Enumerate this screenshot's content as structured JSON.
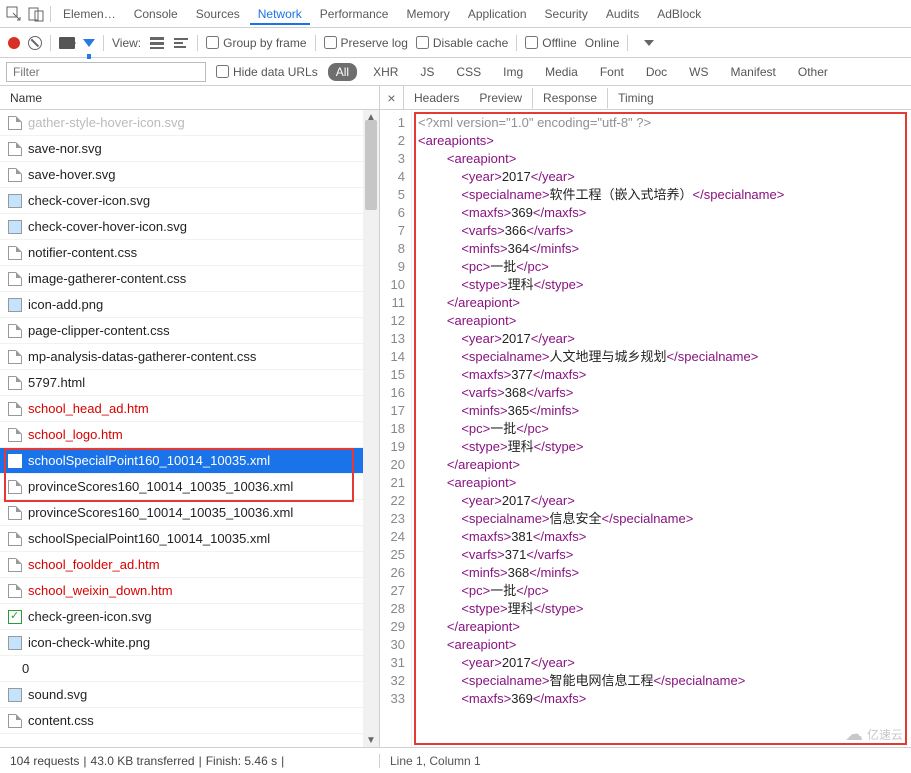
{
  "top_tabs": {
    "t0": "Elemen…",
    "t1": "Console",
    "t2": "Sources",
    "t3": "Network",
    "t4": "Performance",
    "t5": "Memory",
    "t6": "Application",
    "t7": "Security",
    "t8": "Audits",
    "t9": "AdBlock"
  },
  "toolbar": {
    "view": "View:",
    "group": "Group by frame",
    "preserve": "Preserve log",
    "disable": "Disable cache",
    "offline": "Offline",
    "online": "Online"
  },
  "filter": {
    "placeholder": "Filter",
    "hide": "Hide data URLs",
    "types": {
      "all": "All",
      "xhr": "XHR",
      "js": "JS",
      "css": "CSS",
      "img": "Img",
      "media": "Media",
      "font": "Font",
      "doc": "Doc",
      "ws": "WS",
      "manifest": "Manifest",
      "other": "Other"
    }
  },
  "name_header": "Name",
  "files": [
    {
      "label": "gather-style-hover-icon.svg",
      "cls": "",
      "ico": "doc"
    },
    {
      "label": "save-nor.svg",
      "cls": "",
      "ico": "doc"
    },
    {
      "label": "save-hover.svg",
      "cls": "",
      "ico": "doc"
    },
    {
      "label": "check-cover-icon.svg",
      "cls": "",
      "ico": "img"
    },
    {
      "label": "check-cover-hover-icon.svg",
      "cls": "",
      "ico": "img"
    },
    {
      "label": "notifier-content.css",
      "cls": "",
      "ico": "doc"
    },
    {
      "label": "image-gatherer-content.css",
      "cls": "",
      "ico": "doc"
    },
    {
      "label": "icon-add.png",
      "cls": "",
      "ico": "img"
    },
    {
      "label": "page-clipper-content.css",
      "cls": "",
      "ico": "doc"
    },
    {
      "label": "mp-analysis-datas-gatherer-content.css",
      "cls": "",
      "ico": "doc"
    },
    {
      "label": "5797.html",
      "cls": "",
      "ico": "doc"
    },
    {
      "label": "school_head_ad.htm",
      "cls": "redlink",
      "ico": "doc"
    },
    {
      "label": "school_logo.htm",
      "cls": "redlink",
      "ico": "doc"
    },
    {
      "label": "schoolSpecialPoint160_10014_10035.xml",
      "cls": "sel",
      "ico": "doc"
    },
    {
      "label": "provinceScores160_10014_10035_10036.xml",
      "cls": "",
      "ico": "doc"
    },
    {
      "label": "provinceScores160_10014_10035_10036.xml",
      "cls": "",
      "ico": "doc"
    },
    {
      "label": "schoolSpecialPoint160_10014_10035.xml",
      "cls": "",
      "ico": "doc"
    },
    {
      "label": "school_foolder_ad.htm",
      "cls": "redlink",
      "ico": "doc"
    },
    {
      "label": "school_weixin_down.htm",
      "cls": "redlink",
      "ico": "doc"
    },
    {
      "label": "check-green-icon.svg",
      "cls": "",
      "ico": "chk"
    },
    {
      "label": "icon-check-white.png",
      "cls": "",
      "ico": "img"
    },
    {
      "label": "0",
      "cls": "",
      "ico": "zero"
    },
    {
      "label": "sound.svg",
      "cls": "",
      "ico": "img"
    },
    {
      "label": "content.css",
      "cls": "",
      "ico": "doc"
    }
  ],
  "resp_tabs": {
    "headers": "Headers",
    "preview": "Preview",
    "response": "Response",
    "timing": "Timing"
  },
  "status": {
    "requests": "104 requests",
    "sep1": "|",
    "transferred": "43.0 KB transferred",
    "sep2": "|",
    "finish": "Finish: 5.46 s",
    "sep3": "|",
    "cursor": "Line 1, Column 1"
  },
  "code_lines": [
    {
      "html": "<span class='cmt'>&lt;?xml version=\"1.0\" encoding=\"utf-8\" ?&gt;</span>"
    },
    {
      "html": "<span class='t'>&lt;areapionts&gt;</span>"
    },
    {
      "html": "        <span class='t'>&lt;areapiont&gt;</span>"
    },
    {
      "html": "            <span class='t'>&lt;year&gt;</span>2017<span class='t'>&lt;/year&gt;</span>"
    },
    {
      "html": "            <span class='t'>&lt;specialname&gt;</span>软件工程（嵌入式培养）<span class='t'>&lt;/specialname&gt;</span>"
    },
    {
      "html": "            <span class='t'>&lt;maxfs&gt;</span>369<span class='t'>&lt;/maxfs&gt;</span>"
    },
    {
      "html": "            <span class='t'>&lt;varfs&gt;</span>366<span class='t'>&lt;/varfs&gt;</span>"
    },
    {
      "html": "            <span class='t'>&lt;minfs&gt;</span>364<span class='t'>&lt;/minfs&gt;</span>"
    },
    {
      "html": "            <span class='t'>&lt;pc&gt;</span>一批<span class='t'>&lt;/pc&gt;</span>"
    },
    {
      "html": "            <span class='t'>&lt;stype&gt;</span>理科<span class='t'>&lt;/stype&gt;</span>"
    },
    {
      "html": "        <span class='t'>&lt;/areapiont&gt;</span>"
    },
    {
      "html": "        <span class='t'>&lt;areapiont&gt;</span>"
    },
    {
      "html": "            <span class='t'>&lt;year&gt;</span>2017<span class='t'>&lt;/year&gt;</span>"
    },
    {
      "html": "            <span class='t'>&lt;specialname&gt;</span>人文地理与城乡规划<span class='t'>&lt;/specialname&gt;</span>"
    },
    {
      "html": "            <span class='t'>&lt;maxfs&gt;</span>377<span class='t'>&lt;/maxfs&gt;</span>"
    },
    {
      "html": "            <span class='t'>&lt;varfs&gt;</span>368<span class='t'>&lt;/varfs&gt;</span>"
    },
    {
      "html": "            <span class='t'>&lt;minfs&gt;</span>365<span class='t'>&lt;/minfs&gt;</span>"
    },
    {
      "html": "            <span class='t'>&lt;pc&gt;</span>一批<span class='t'>&lt;/pc&gt;</span>"
    },
    {
      "html": "            <span class='t'>&lt;stype&gt;</span>理科<span class='t'>&lt;/stype&gt;</span>"
    },
    {
      "html": "        <span class='t'>&lt;/areapiont&gt;</span>"
    },
    {
      "html": "        <span class='t'>&lt;areapiont&gt;</span>"
    },
    {
      "html": "            <span class='t'>&lt;year&gt;</span>2017<span class='t'>&lt;/year&gt;</span>"
    },
    {
      "html": "            <span class='t'>&lt;specialname&gt;</span>信息安全<span class='t'>&lt;/specialname&gt;</span>"
    },
    {
      "html": "            <span class='t'>&lt;maxfs&gt;</span>381<span class='t'>&lt;/maxfs&gt;</span>"
    },
    {
      "html": "            <span class='t'>&lt;varfs&gt;</span>371<span class='t'>&lt;/varfs&gt;</span>"
    },
    {
      "html": "            <span class='t'>&lt;minfs&gt;</span>368<span class='t'>&lt;/minfs&gt;</span>"
    },
    {
      "html": "            <span class='t'>&lt;pc&gt;</span>一批<span class='t'>&lt;/pc&gt;</span>"
    },
    {
      "html": "            <span class='t'>&lt;stype&gt;</span>理科<span class='t'>&lt;/stype&gt;</span>"
    },
    {
      "html": "        <span class='t'>&lt;/areapiont&gt;</span>"
    },
    {
      "html": "        <span class='t'>&lt;areapiont&gt;</span>"
    },
    {
      "html": "            <span class='t'>&lt;year&gt;</span>2017<span class='t'>&lt;/year&gt;</span>"
    },
    {
      "html": "            <span class='t'>&lt;specialname&gt;</span>智能电网信息工程<span class='t'>&lt;/specialname&gt;</span>"
    },
    {
      "html": "            <span class='t'>&lt;maxfs&gt;</span>369<span class='t'>&lt;/maxfs&gt;</span>"
    }
  ],
  "watermark": "亿速云"
}
